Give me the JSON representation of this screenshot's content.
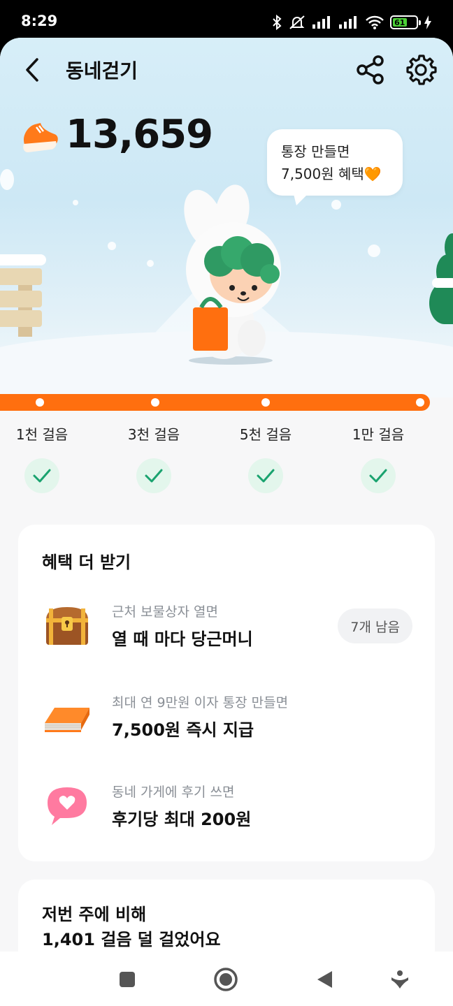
{
  "status_bar": {
    "time": "8:29",
    "battery": "61"
  },
  "header": {
    "title": "동네걷기"
  },
  "steps": {
    "count": "13,659"
  },
  "bubble": {
    "line1": "통장 만들면",
    "line2": "7,500원 혜택🧡"
  },
  "progress": {
    "fraction": 1.0
  },
  "milestones": [
    {
      "label": "1천 걸음",
      "done": true
    },
    {
      "label": "3천 걸음",
      "done": true
    },
    {
      "label": "5천 걸음",
      "done": true
    },
    {
      "label": "1만 걸음",
      "done": true
    }
  ],
  "benefits": {
    "title": "혜택 더 받기",
    "items": [
      {
        "icon": "treasure-chest-icon",
        "sub": "근처 보물상자 열면",
        "main": "열 때 마다 당근머니",
        "badge": "7개 남음"
      },
      {
        "icon": "bankbook-icon",
        "sub": "최대 연 9만원 이자 통장 만들면",
        "main": "7,500원 즉시 지급"
      },
      {
        "icon": "heart-speech-icon",
        "sub": "동네 가게에 후기 쓰면",
        "main": "후기당 최대 200원"
      }
    ]
  },
  "compare": {
    "line1": "저번 주에 비해",
    "line2": "1,401 걸음 덜 걸었어요"
  },
  "colors": {
    "accent": "#ff6f0f",
    "check_green": "#1aa36f"
  }
}
